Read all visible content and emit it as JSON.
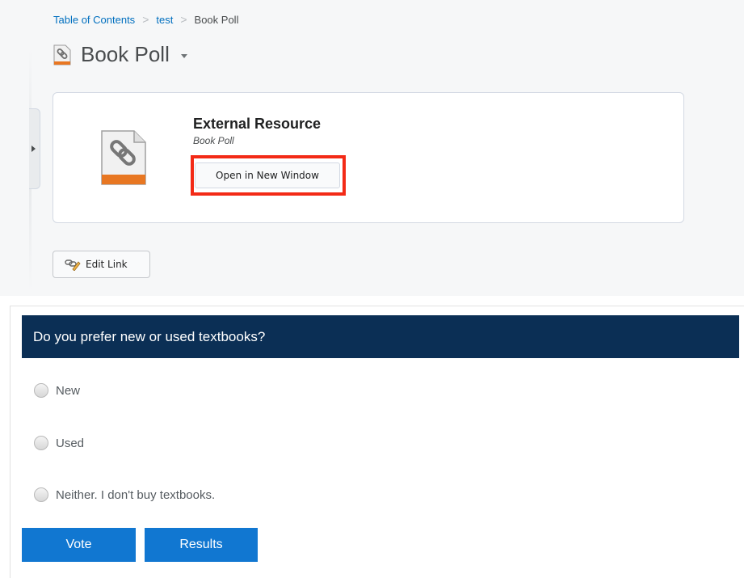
{
  "breadcrumb": {
    "items": [
      "Table of Contents",
      "test"
    ],
    "current": "Book Poll",
    "separator": ">"
  },
  "page_title": "Book Poll",
  "resource": {
    "heading": "External Resource",
    "subtitle": "Book Poll",
    "open_button": "Open in New Window",
    "icon": "link-document-icon"
  },
  "edit_link_button": "Edit Link",
  "poll": {
    "question": "Do you prefer new or used textbooks?",
    "options": [
      "New",
      "Used",
      "Neither. I don't buy textbooks."
    ],
    "vote_button": "Vote",
    "results_button": "Results"
  },
  "colors": {
    "poll_header_bg": "#0b2f55",
    "button_blue": "#1177d1",
    "highlight_red": "#f32a16",
    "link_blue": "#006fbf",
    "icon_orange": "#e87722"
  }
}
